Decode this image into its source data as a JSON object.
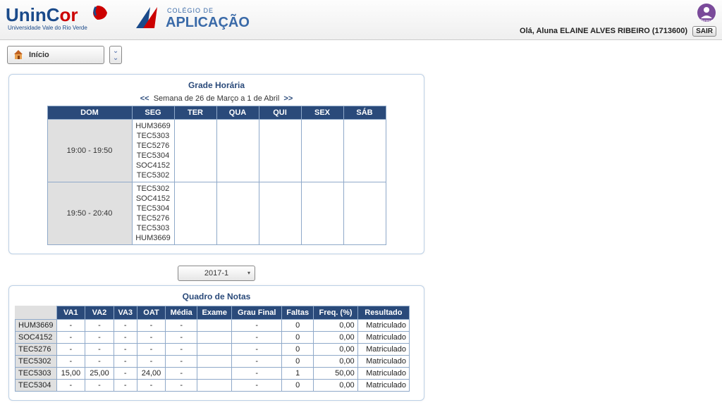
{
  "header": {
    "greeting_prefix": "Olá, ",
    "greeting_name": "Aluna ELAINE ALVES RIBEIRO (1713600)",
    "sair_label": "SAIR",
    "logo1_name": "UninCor",
    "logo1_sub": "Universidade Vale do Rio Verde",
    "logo2_top": "COLÉGIO DE",
    "logo2_main": "APLICAÇÃO"
  },
  "toolbar": {
    "inicio_label": "Início"
  },
  "schedule": {
    "title": "Grade Horária",
    "nav_prev": "<<",
    "nav_text": "Semana de 26 de Março a 1 de Abril",
    "nav_next": ">>",
    "days": {
      "dom": "DOM",
      "seg": "SEG",
      "ter": "TER",
      "qua": "QUA",
      "qui": "QUI",
      "sex": "SEX",
      "sab": "SÁB"
    },
    "rows": [
      {
        "time": "19:00 - 19:50",
        "seg": [
          "HUM3669",
          "TEC5303",
          "TEC5276",
          "TEC5304",
          "SOC4152",
          "TEC5302"
        ]
      },
      {
        "time": "19:50 - 20:40",
        "seg": [
          "TEC5302",
          "SOC4152",
          "TEC5304",
          "TEC5276",
          "TEC5303",
          "HUM3669"
        ]
      }
    ]
  },
  "semester": {
    "selected": "2017-1"
  },
  "grades": {
    "title": "Quadro de Notas",
    "headers": {
      "va1": "VA1",
      "va2": "VA2",
      "va3": "VA3",
      "oat": "OAT",
      "media": "Média",
      "exame": "Exame",
      "grau": "Grau Final",
      "faltas": "Faltas",
      "freq": "Freq. (%)",
      "res": "Resultado"
    },
    "rows": [
      {
        "disc": "HUM3669",
        "va1": "-",
        "va2": "-",
        "va3": "-",
        "oat": "-",
        "media": "-",
        "exame": "",
        "grau": "-",
        "faltas": "0",
        "freq": "0,00",
        "res": "Matriculado"
      },
      {
        "disc": "SOC4152",
        "va1": "-",
        "va2": "-",
        "va3": "-",
        "oat": "-",
        "media": "-",
        "exame": "",
        "grau": "-",
        "faltas": "0",
        "freq": "0,00",
        "res": "Matriculado"
      },
      {
        "disc": "TEC5276",
        "va1": "-",
        "va2": "-",
        "va3": "-",
        "oat": "-",
        "media": "-",
        "exame": "",
        "grau": "-",
        "faltas": "0",
        "freq": "0,00",
        "res": "Matriculado"
      },
      {
        "disc": "TEC5302",
        "va1": "-",
        "va2": "-",
        "va3": "-",
        "oat": "-",
        "media": "-",
        "exame": "",
        "grau": "-",
        "faltas": "0",
        "freq": "0,00",
        "res": "Matriculado"
      },
      {
        "disc": "TEC5303",
        "va1": "15,00",
        "va2": "25,00",
        "va3": "-",
        "oat": "24,00",
        "media": "-",
        "exame": "",
        "grau": "-",
        "faltas": "1",
        "freq": "50,00",
        "res": "Matriculado"
      },
      {
        "disc": "TEC5304",
        "va1": "-",
        "va2": "-",
        "va3": "-",
        "oat": "-",
        "media": "-",
        "exame": "",
        "grau": "-",
        "faltas": "0",
        "freq": "0,00",
        "res": "Matriculado"
      }
    ]
  }
}
